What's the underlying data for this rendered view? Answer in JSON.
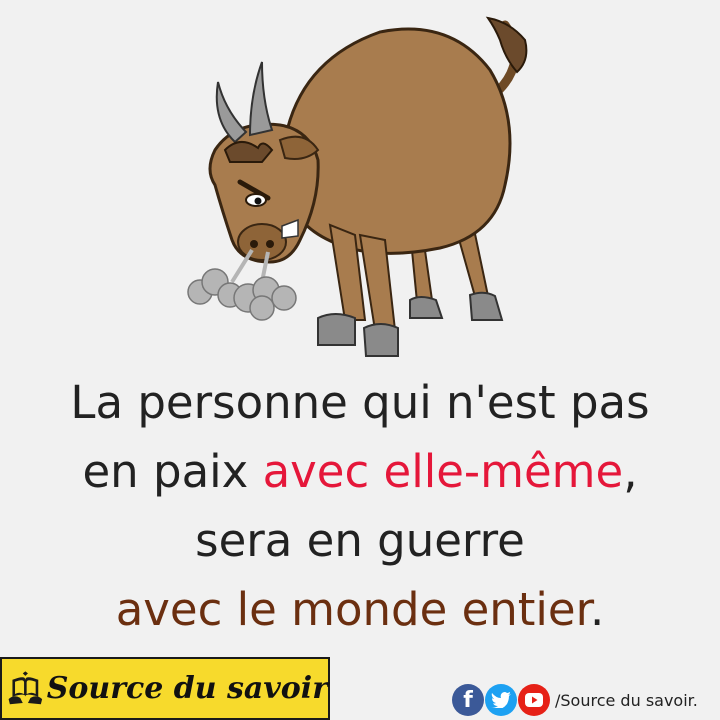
{
  "illustration": {
    "subject": "angry-bull",
    "body_color": "#a87c4e",
    "smoke_color": "#b5b5b5"
  },
  "quote": {
    "line1": "La personne qui n'est pas",
    "line2_start": "en paix ",
    "line2_highlight": "avec elle-même",
    "line2_end": ",",
    "line3": "sera en guerre",
    "line4_highlight": "avec le monde entier",
    "line4_end": "."
  },
  "colors": {
    "text": "#222222",
    "highlight_red": "#e5173a",
    "highlight_brown": "#6b2f10",
    "banner": "#f7da2c",
    "background": "#f1f1f1"
  },
  "brand": {
    "name": "Source du savoir",
    "logo_icon": "book-with-hands-icon"
  },
  "social": {
    "icons": [
      "facebook-icon",
      "twitter-icon",
      "youtube-icon"
    ],
    "facebook_glyph": "f",
    "handle": "/Source du savoir."
  }
}
